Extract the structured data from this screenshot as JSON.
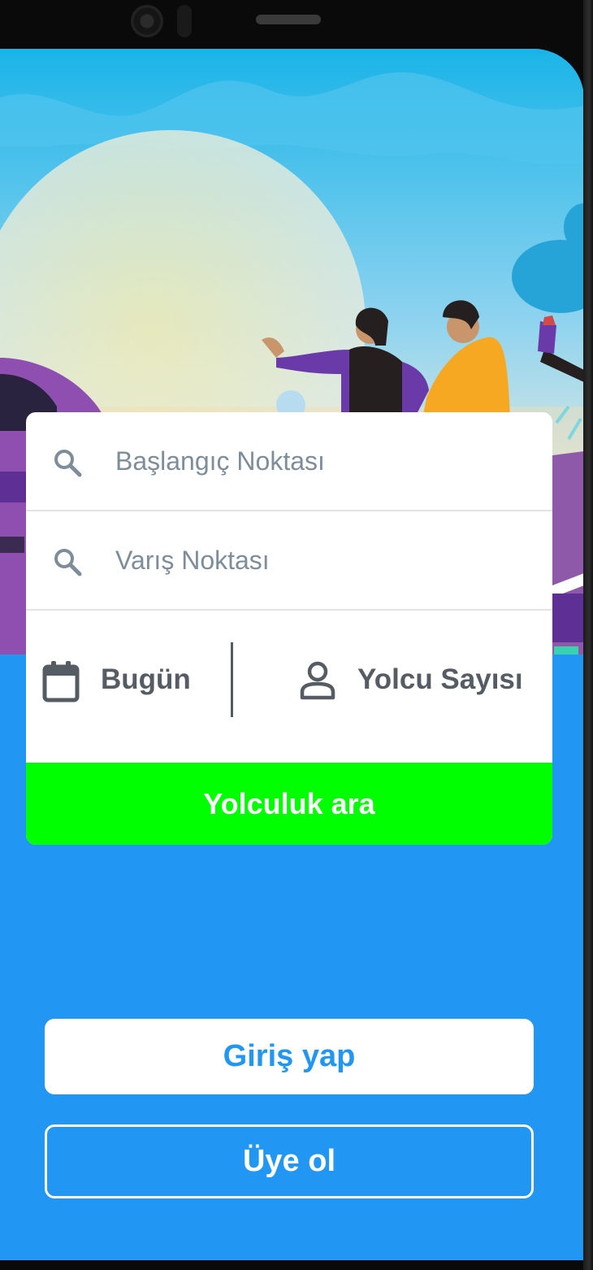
{
  "search": {
    "origin_placeholder": "Başlangıç Noktası",
    "destination_placeholder": "Varış Noktası",
    "date_label": "Bugün",
    "passengers_label": "Yolcu Sayısı",
    "search_button_label": "Yolculuk ara"
  },
  "auth": {
    "login_label": "Giriş yap",
    "signup_label": "Üye ol"
  },
  "colors": {
    "primary": "#2196f3",
    "search_button": "#00ff00",
    "field_text": "#7d8d99",
    "label_text": "#555c63"
  },
  "icons": {
    "origin": "search-icon",
    "destination": "search-icon",
    "date": "calendar-icon",
    "passengers": "person-icon"
  }
}
